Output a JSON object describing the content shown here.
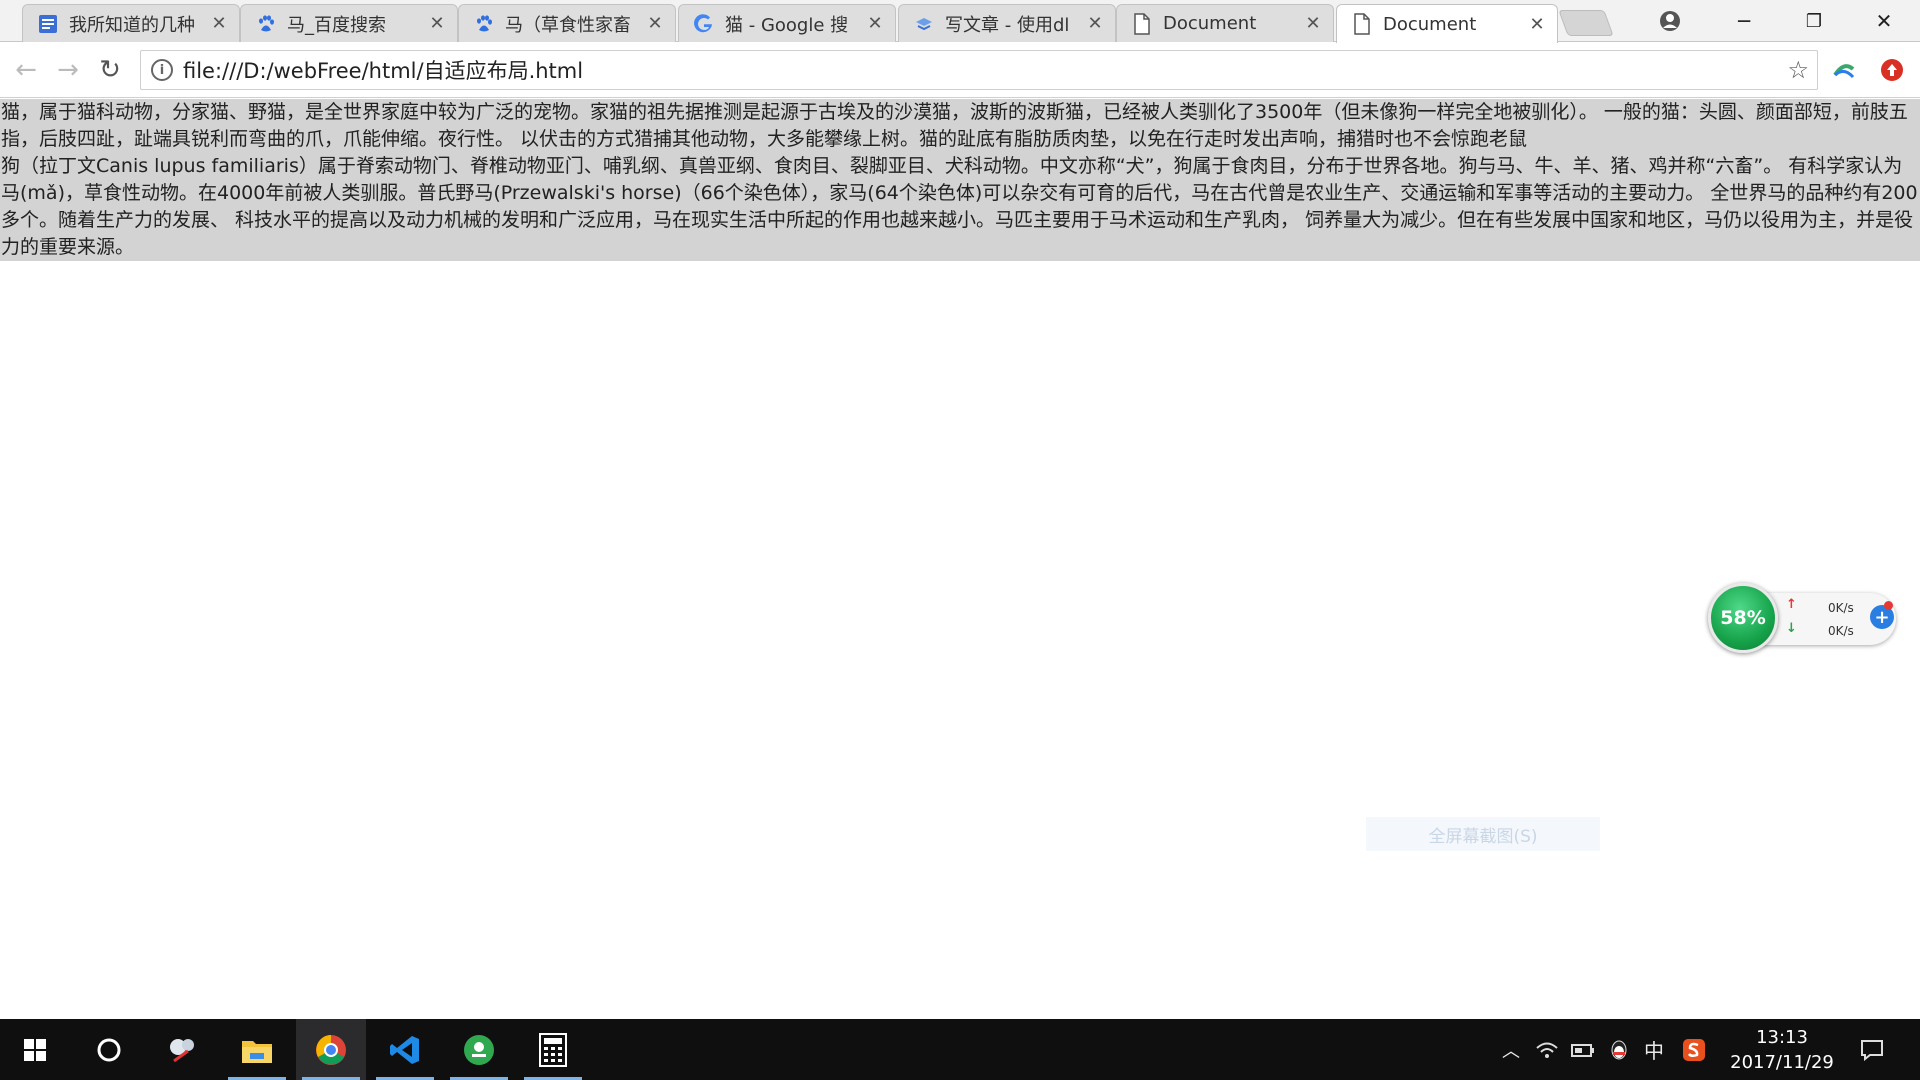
{
  "browser": {
    "tabs": [
      {
        "label": "我所知道的几种",
        "icon": "document-book-icon",
        "active": false
      },
      {
        "label": "马_百度搜索",
        "icon": "baidu-paw-icon",
        "active": false
      },
      {
        "label": "马（草食性家畜",
        "icon": "baidu-paw-icon",
        "active": false
      },
      {
        "label": "猫 - Google 搜",
        "icon": "google-g-icon",
        "active": false
      },
      {
        "label": "写文章 - 使用dl",
        "icon": "csdn-icon",
        "active": false
      },
      {
        "label": "Document",
        "icon": "page-icon",
        "active": false
      },
      {
        "label": "Document",
        "icon": "page-icon",
        "active": true
      }
    ],
    "tab_close_glyph": "✕",
    "window_controls": {
      "minimize": "─",
      "restore": "❐",
      "close": "✕"
    },
    "url": "file:///D:/webFree/html/自适应布局.html"
  },
  "page": {
    "paragraphs": [
      {
        "name": "cat",
        "text": "猫，属于猫科动物，分家猫、野猫，是全世界家庭中较为广泛的宠物。家猫的祖先据推测是起源于古埃及的沙漠猫，波斯的波斯猫，已经被人类驯化了3500年（但未像狗一样完全地被驯化）。 一般的猫：头圆、颜面部短，前肢五指，后肢四趾，趾端具锐利而弯曲的爪，爪能伸缩。夜行性。 以伏击的方式猎捕其他动物，大多能攀缘上树。猫的趾底有脂肪质肉垫，以免在行走时发出声响，捕猎时也不会惊跑老鼠"
      },
      {
        "name": "dog",
        "text": "狗（拉丁文Canis lupus familiaris）属于脊索动物门、脊椎动物亚门、哺乳纲、真兽亚纲、食肉目、裂脚亚目、犬科动物。中文亦称“犬”，狗属于食肉目，分布于世界各地。狗与马、牛、羊、猪、鸡并称“六畜”。 有科学家认为狗是由早期人类从灰狼驯化而来，驯养时间在4万年前~1.5万年前，发展至今日。被称为“人类最忠实的朋友”，现如今是饲养率最高的宠物。其寿命约十多年。"
      },
      {
        "name": "horse",
        "text": "马(mǎ)，草食性动物。在4000年前被人类驯服。普氏野马(Przewalski's horse)（66个染色体），家马(64个染色体)可以杂交有可育的后代，马在古代曾是农业生产、交通运输和军事等活动的主要动力。 全世界马的品种约有200多个。随着生产力的发展、 科技水平的提高以及动力机械的发明和广泛应用，马在现实生活中所起的作用也越来越小。马匹主要用于马术运动和生产乳肉， 饲养量大为减少。但在有些发展中国家和地区，马仍以役用为主，并是役力的重要来源。"
      }
    ]
  },
  "net_widget": {
    "percent": "58%",
    "upload_rate": "0K/s",
    "download_rate": "0K/s"
  },
  "ghost_tooltip": "全屏幕截图(S)",
  "taskbar": {
    "ime_label": "中",
    "time": "13:13",
    "date": "2017/11/29"
  }
}
